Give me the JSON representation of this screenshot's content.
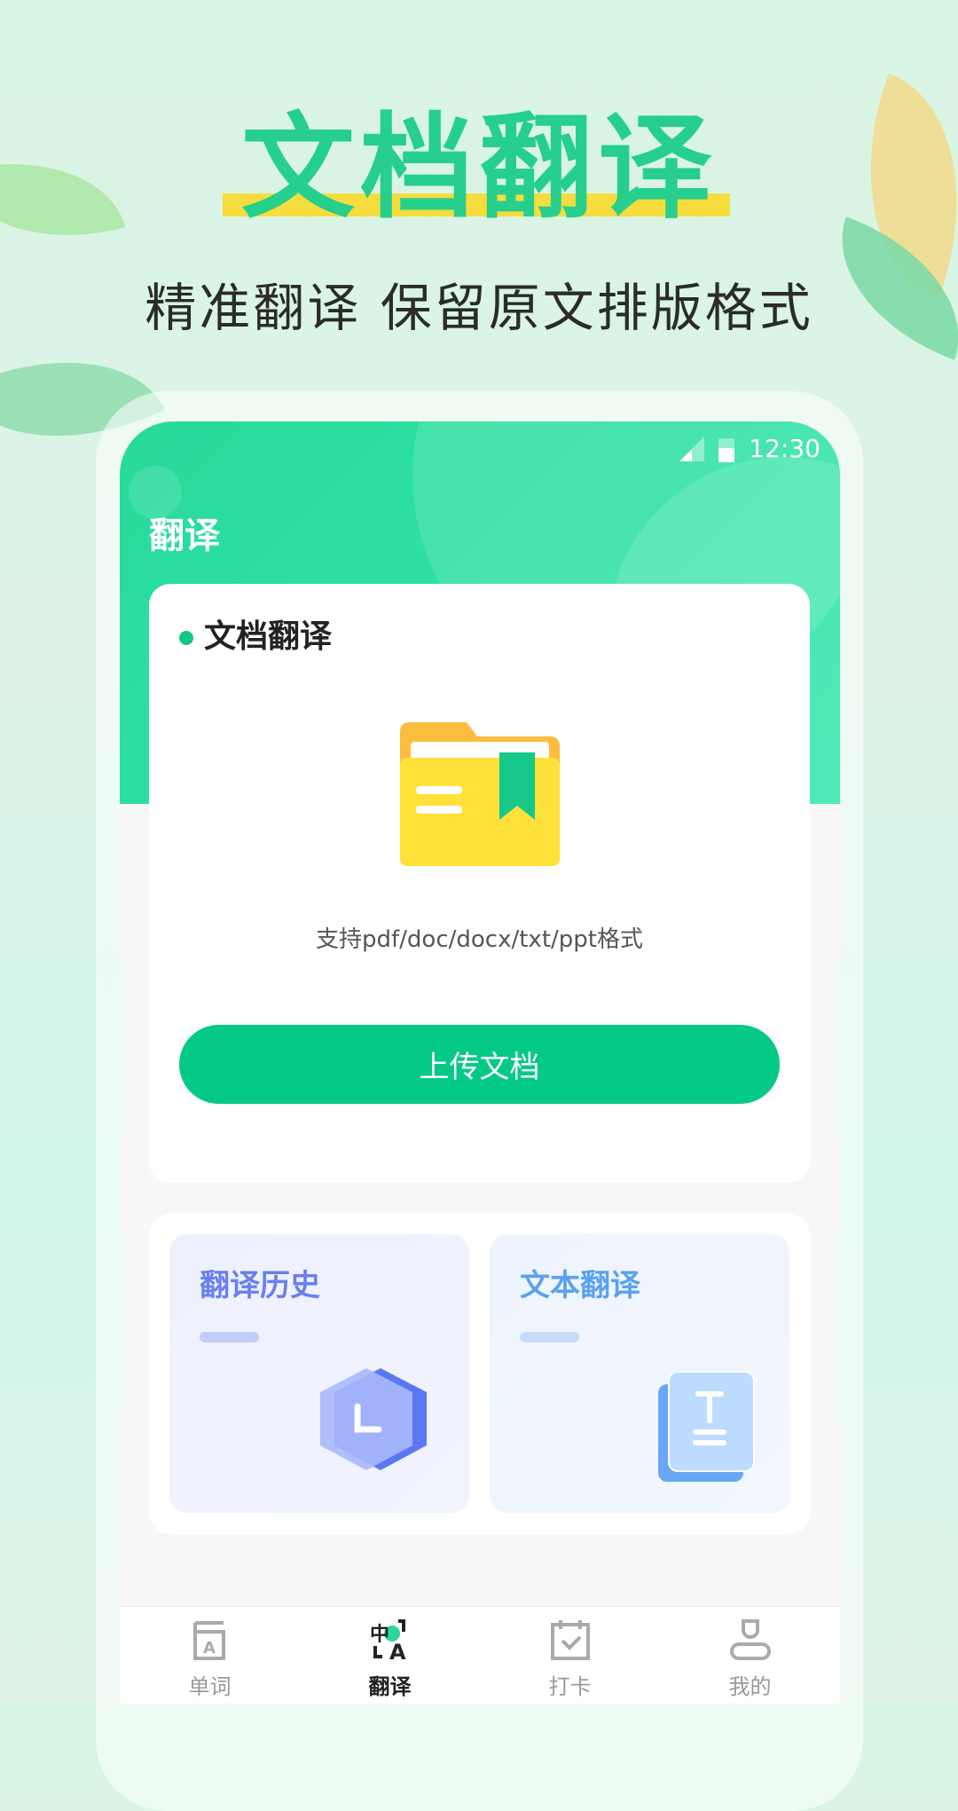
{
  "hero": {
    "title": "文档翻译",
    "subtitle": "精准翻译 保留原文排版格式"
  },
  "status_bar": {
    "time": "12:30"
  },
  "header": {
    "title": "翻译"
  },
  "doc_card": {
    "title": "文档翻译",
    "support_text": "支持pdf/doc/docx/txt/ppt格式",
    "upload_label": "上传文档"
  },
  "tiles": [
    {
      "title": "翻译历史",
      "icon": "clock-hexagon-icon"
    },
    {
      "title": "文本翻译",
      "icon": "text-document-icon"
    }
  ],
  "nav": {
    "items": [
      {
        "label": "单词",
        "icon": "word-book-icon"
      },
      {
        "label": "翻译",
        "icon": "translate-icon",
        "active": true
      },
      {
        "label": "打卡",
        "icon": "calendar-check-icon"
      },
      {
        "label": "我的",
        "icon": "user-icon"
      }
    ]
  },
  "colors": {
    "accent": "#05c986",
    "title_green": "#26cf8c",
    "highlight_yellow": "#f6dc3c"
  }
}
